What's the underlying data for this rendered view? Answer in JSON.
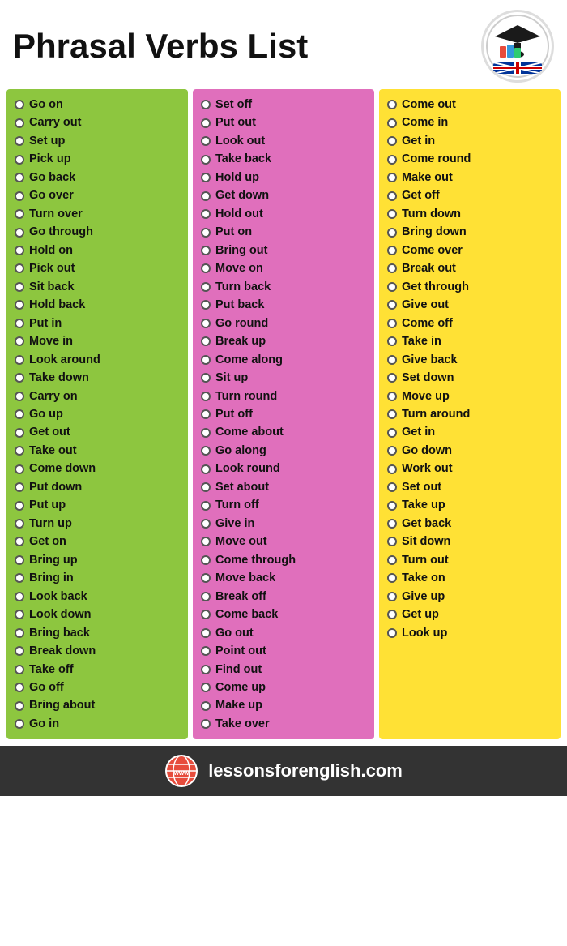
{
  "header": {
    "title": "Phrasal Verbs List"
  },
  "footer": {
    "url": "lessonsforenglish.com"
  },
  "columns": [
    {
      "id": "green",
      "color": "col-green",
      "items": [
        "Go on",
        "Carry out",
        "Set up",
        "Pick up",
        "Go back",
        "Go over",
        "Turn over",
        "Go through",
        "Hold on",
        "Pick out",
        "Sit back",
        "Hold back",
        "Put in",
        "Move in",
        "Look around",
        "Take down",
        "Carry on",
        "Go up",
        "Get out",
        "Take out",
        "Come down",
        "Put down",
        "Put up",
        "Turn up",
        "Get on",
        "Bring up",
        "Bring in",
        "Look back",
        "Look down",
        "Bring back",
        "Break down",
        "Take off",
        "Go off",
        "Bring about",
        "Go in"
      ]
    },
    {
      "id": "pink",
      "color": "col-pink",
      "items": [
        "Set off",
        "Put out",
        "Look out",
        "Take back",
        "Hold up",
        "Get down",
        "Hold out",
        "Put on",
        "Bring out",
        "Move on",
        "Turn back",
        "Put back",
        "Go round",
        "Break up",
        "Come along",
        "Sit up",
        "Turn round",
        "Put off",
        "Come about",
        "Go along",
        "Look round",
        "Set about",
        "Turn off",
        "Give in",
        "Move out",
        "Come through",
        "Move back",
        "Break off",
        "Come back",
        "Go out",
        "Point out",
        "Find out",
        "Come up",
        "Make up",
        "Take over"
      ]
    },
    {
      "id": "yellow",
      "color": "col-yellow",
      "items": [
        "Come out",
        "Come in",
        "Get in",
        "Come round",
        "Make out",
        "Get off",
        "Turn down",
        "Bring down",
        "Come over",
        "Break out",
        "Get through",
        "Give out",
        "Come off",
        "Take in",
        "Give back",
        "Set down",
        "Move up",
        "Turn around",
        "Get in",
        "Go down",
        "Work out",
        "Set out",
        "Take up",
        "Get back",
        "Sit down",
        "Turn out",
        "Take on",
        "Give up",
        "Get up",
        "Look up"
      ]
    }
  ]
}
